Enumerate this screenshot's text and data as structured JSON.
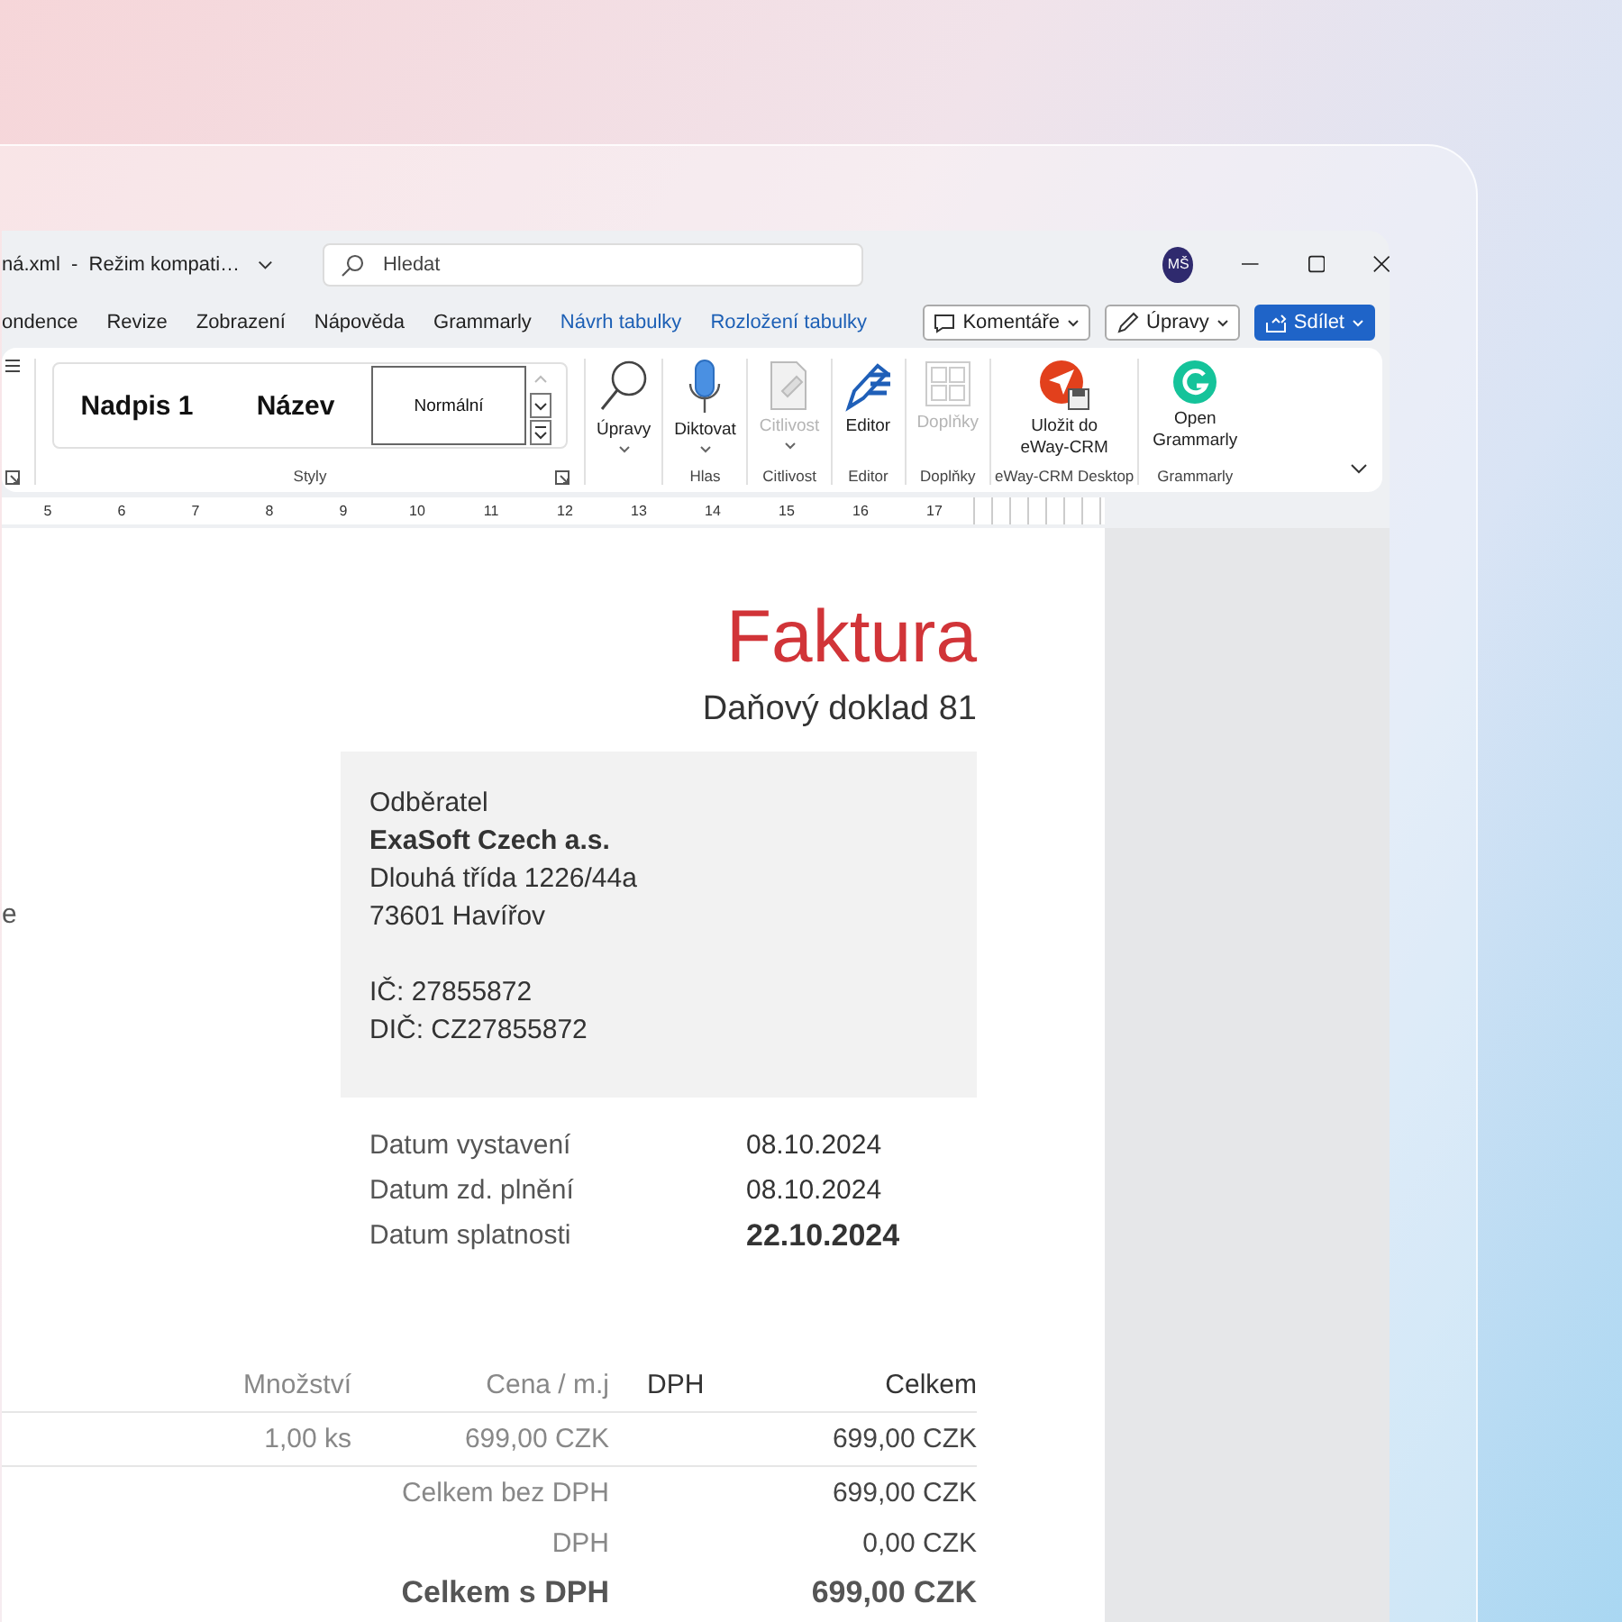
{
  "title_bar": {
    "document_title": "ná.xml  -  Režim kompati…",
    "search": {
      "placeholder": "Hledat"
    },
    "avatar": "MŠ"
  },
  "tabs": [
    {
      "label": "ondence",
      "contextual": false
    },
    {
      "label": "Revize",
      "contextual": false
    },
    {
      "label": "Zobrazení",
      "contextual": false
    },
    {
      "label": "Nápověda",
      "contextual": false
    },
    {
      "label": "Grammarly",
      "contextual": false
    },
    {
      "label": "Návrh tabulky",
      "contextual": true
    },
    {
      "label": "Rozložení tabulky",
      "contextual": true
    }
  ],
  "actions": [
    {
      "label": "Komentáře",
      "kind": "comment"
    },
    {
      "label": "Úpravy",
      "kind": "edit"
    },
    {
      "label": "Sdílet",
      "kind": "share"
    }
  ],
  "ribbon": {
    "styles": {
      "group_label": "Styly",
      "items": [
        {
          "label": "Nadpis 1",
          "selected": false
        },
        {
          "label": "Název",
          "selected": false
        },
        {
          "label": "Normální",
          "selected": true
        }
      ]
    },
    "groups": [
      {
        "buttons": [
          {
            "label": "Úpravy",
            "kind": "search",
            "disabled": false,
            "dropdown": true
          }
        ]
      },
      {
        "label": "Hlas",
        "buttons": [
          {
            "label": "Diktovat",
            "kind": "mic",
            "disabled": false,
            "dropdown": true
          }
        ]
      },
      {
        "label": "Citlivost",
        "buttons": [
          {
            "label": "Citlivost",
            "kind": "sensitivity",
            "disabled": true,
            "dropdown": true
          }
        ]
      },
      {
        "label": "Editor",
        "buttons": [
          {
            "label": "Editor",
            "kind": "editor",
            "disabled": false,
            "dropdown": false
          }
        ]
      },
      {
        "label": "Doplňky",
        "buttons": [
          {
            "label": "Doplňky",
            "kind": "addins",
            "disabled": true,
            "dropdown": false
          }
        ]
      },
      {
        "label": "eWay-CRM Desktop",
        "buttons": [
          {
            "label": "Uložit do eWay-CRM",
            "kind": "eway",
            "disabled": false,
            "dropdown": false
          }
        ]
      },
      {
        "label": "Grammarly",
        "buttons": [
          {
            "label": "Open Grammarly",
            "kind": "grammarly",
            "disabled": false,
            "dropdown": false
          }
        ]
      }
    ]
  },
  "ruler": {
    "numbers": [
      "5",
      "6",
      "7",
      "8",
      "9",
      "10",
      "11",
      "12",
      "13",
      "14",
      "15",
      "16",
      "17"
    ]
  },
  "document": {
    "title": "Faktura",
    "subtitle": "Daňový doklad 81",
    "left_fragment": "e",
    "customer": {
      "heading": "Odběratel",
      "name": "ExaSoft Czech a.s.",
      "address": [
        "Dlouhá třída 1226/44a",
        "73601 Havířov"
      ],
      "ids": [
        "IČ: 27855872",
        "DIČ: CZ27855872"
      ]
    },
    "dates": [
      {
        "label": "Datum vystavení",
        "value": "08.10.2024",
        "emphasized": false
      },
      {
        "label": "Datum zd. plnění",
        "value": "08.10.2024",
        "emphasized": false
      },
      {
        "label": "Datum splatnosti",
        "value": "22.10.2024",
        "emphasized": true
      }
    ],
    "items_table": {
      "columns": [
        "Množství",
        "Cena / m.j",
        "DPH",
        "Celkem"
      ],
      "rows": [
        {
          "quantity": "1,00 ks",
          "unit_price": "699,00 CZK",
          "total": "699,00 CZK"
        }
      ]
    },
    "totals": [
      {
        "label": "Celkem bez DPH",
        "value": "699,00 CZK",
        "emphasized": false
      },
      {
        "label": "DPH",
        "value": "0,00 CZK",
        "emphasized": false
      },
      {
        "label": "Celkem s DPH",
        "value": "699,00 CZK",
        "emphasized": true
      }
    ]
  }
}
